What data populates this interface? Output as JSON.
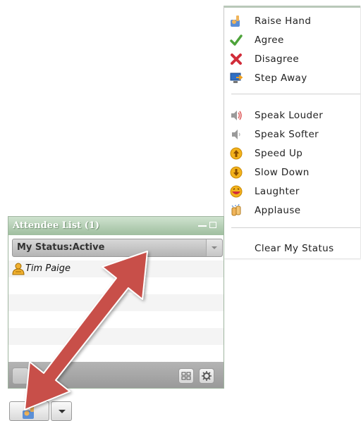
{
  "menu": {
    "items": [
      {
        "label": "Raise Hand",
        "icon": "raise-hand-icon"
      },
      {
        "label": "Agree",
        "icon": "checkmark-icon"
      },
      {
        "label": "Disagree",
        "icon": "red-x-icon"
      },
      {
        "label": "Step Away",
        "icon": "step-away-icon"
      },
      {
        "label": "Speak Louder",
        "icon": "speak-louder-icon"
      },
      {
        "label": "Speak Softer",
        "icon": "speak-softer-icon"
      },
      {
        "label": "Speed Up",
        "icon": "speed-up-icon"
      },
      {
        "label": "Slow Down",
        "icon": "slow-down-icon"
      },
      {
        "label": "Laughter",
        "icon": "laughter-icon"
      },
      {
        "label": "Applause",
        "icon": "applause-icon"
      }
    ],
    "clear_label": "Clear My Status"
  },
  "attendee_panel": {
    "title": "Attendee List (1)",
    "status": "My Status:Active",
    "attendees": [
      {
        "name": "Tim Paige",
        "icon": "host-user-icon"
      }
    ]
  },
  "colors": {
    "panel_header": "#a9c6a9",
    "annotation_arrow": "#c8504a",
    "footer": "#a4a4a4"
  }
}
